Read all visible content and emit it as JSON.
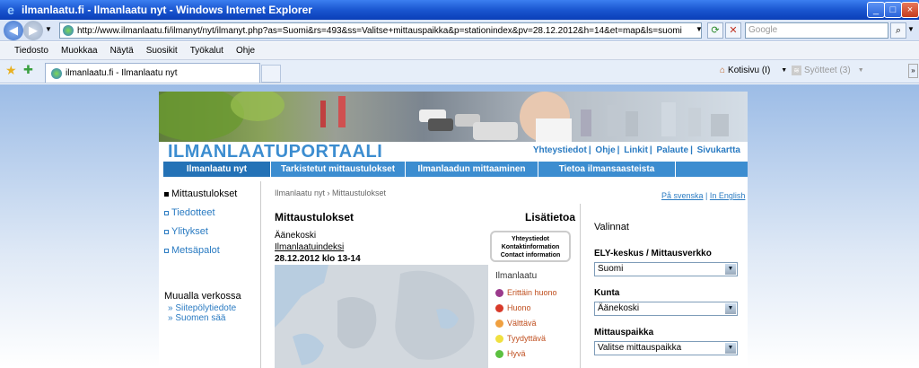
{
  "window": {
    "title": "ilmanlaatu.fi - Ilmanlaatu nyt - Windows Internet Explorer"
  },
  "address": {
    "url": "http://www.ilmanlaatu.fi/ilmanyt/nyt/ilmanyt.php?as=Suomi&rs=493&ss=Valitse+mittauspaikka&p=stationindex&pv=28.12.2012&h=14&et=map&ls=suomi",
    "search_placeholder": "Google"
  },
  "menu": [
    "Tiedosto",
    "Muokkaa",
    "Näytä",
    "Suosikit",
    "Työkalut",
    "Ohje"
  ],
  "tab": {
    "label": "ilmanlaatu.fi - Ilmanlaatu nyt"
  },
  "toolbar": {
    "home": "Kotisivu (I)",
    "feeds": "Syötteet (3)"
  },
  "site": {
    "logo": "ILMANLAATUPORTAALI",
    "toplinks": [
      "Yhteystiedot",
      "Ohje",
      "Linkit",
      "Palaute",
      "Sivukartta"
    ],
    "nav": [
      "Ilmanlaatu nyt",
      "Tarkistetut mittaustulokset",
      "Ilmanlaadun mittaaminen",
      "Tietoa ilmansaasteista"
    ],
    "sidebar": [
      "Mittaustulokset",
      "Tiedotteet",
      "Ylitykset",
      "Metsäpalot"
    ],
    "elsewhere": {
      "heading": "Muualla verkossa",
      "links": [
        "Siitepölytiedote",
        "Suomen sää"
      ]
    },
    "breadcrumb": "Ilmanlaatu nyt › Mittaustulokset",
    "lang_sv": "På svenska",
    "lang_en": "In English",
    "heading": "Mittaustulokset",
    "more": "Lisätietoa",
    "place": "Äänekoski",
    "index_link": "Ilmanlaatuindeksi",
    "datetime": "28.12.2012 klo 13-14",
    "contact": [
      "Yhteystiedot",
      "Kontaktinformation",
      "Contact information"
    ],
    "legend": {
      "title": "Ilmanlaatu",
      "items": [
        {
          "label": "Erittäin huono",
          "color": "#9b3a8c"
        },
        {
          "label": "Huono",
          "color": "#d83a2a"
        },
        {
          "label": "Välttävä",
          "color": "#f0a040"
        },
        {
          "label": "Tyydyttävä",
          "color": "#f0e040"
        },
        {
          "label": "Hyvä",
          "color": "#5cc040"
        }
      ]
    },
    "panel": {
      "title": "Valinnat",
      "ely_label": "ELY-keskus / Mittausverkko",
      "ely_value": "Suomi",
      "kunta_label": "Kunta",
      "kunta_value": "Äänekoski",
      "place_label": "Mittauspaikka",
      "place_value": "Valitse mittauspaikka"
    }
  }
}
